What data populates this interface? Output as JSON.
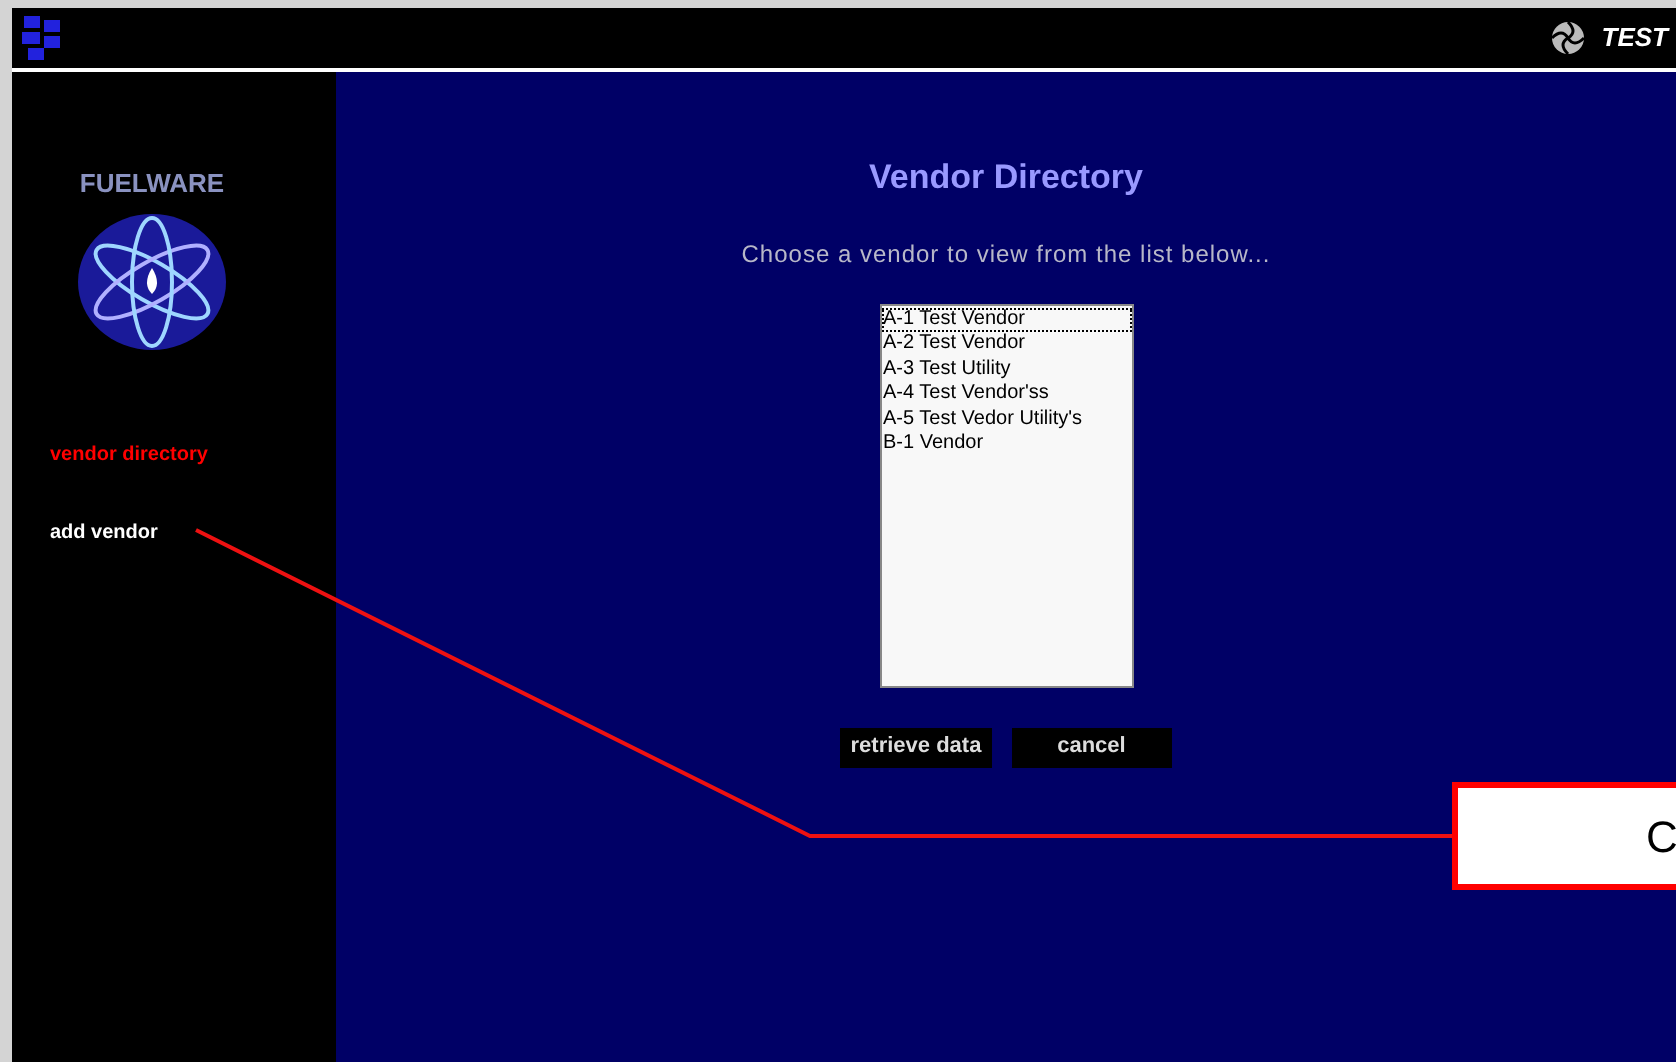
{
  "header": {
    "badge": "TEST"
  },
  "sidebar": {
    "logo_text": "FUELWARE",
    "items": [
      {
        "label": "vendor directory",
        "selected": true
      },
      {
        "label": "add vendor",
        "selected": false
      }
    ]
  },
  "main": {
    "title": "Vendor Directory",
    "instruction": "Choose a vendor to view from the list below...",
    "vendors": [
      {
        "label": "A-1 Test Vendor",
        "selected": true
      },
      {
        "label": "A-2 Test Vendor",
        "selected": false
      },
      {
        "label": "A-3 Test Utility",
        "selected": false
      },
      {
        "label": "A-4 Test Vendor'ss",
        "selected": false
      },
      {
        "label": "A-5 Test Vedor Utility's",
        "selected": false
      },
      {
        "label": "B-1 Vendor",
        "selected": false
      }
    ],
    "buttons": [
      "retrieve data",
      "cancel"
    ]
  },
  "callout": {
    "text": "C"
  }
}
